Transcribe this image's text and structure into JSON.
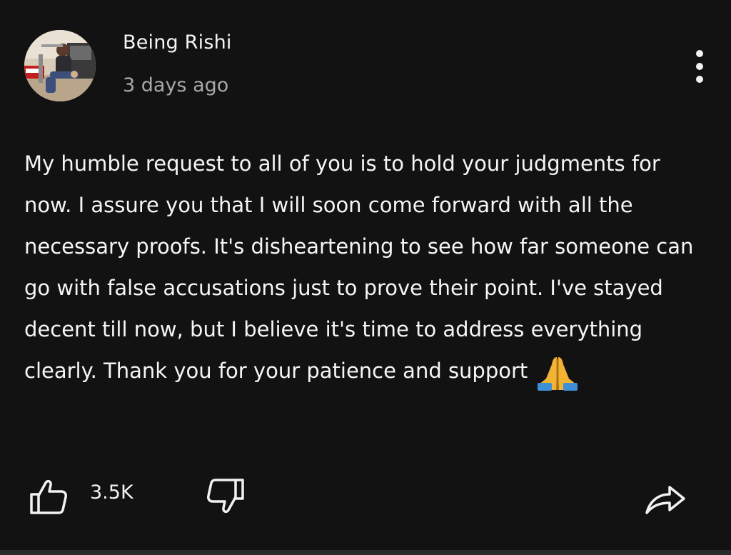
{
  "post": {
    "author": "Being Rishi",
    "timestamp": "3 days ago",
    "body": "My humble request to all of you is to hold your judgments for now. I assure you that I will soon come forward with all the necessary proofs. It's disheartening to see how far someone can go with false accusations just to prove their point. I've stayed decent till now, but I believe it's time to address everything clearly. Thank you for your patience and support",
    "emoji": "folded-hands"
  },
  "actions": {
    "like_count": "3.5K"
  },
  "icons": {
    "more": "more-vertical-icon",
    "like": "thumbs-up-icon",
    "dislike": "thumbs-down-icon",
    "share": "share-arrow-icon"
  },
  "colors": {
    "background": "#121212",
    "text": "#f5f5f5",
    "muted": "#a8a8a8"
  }
}
